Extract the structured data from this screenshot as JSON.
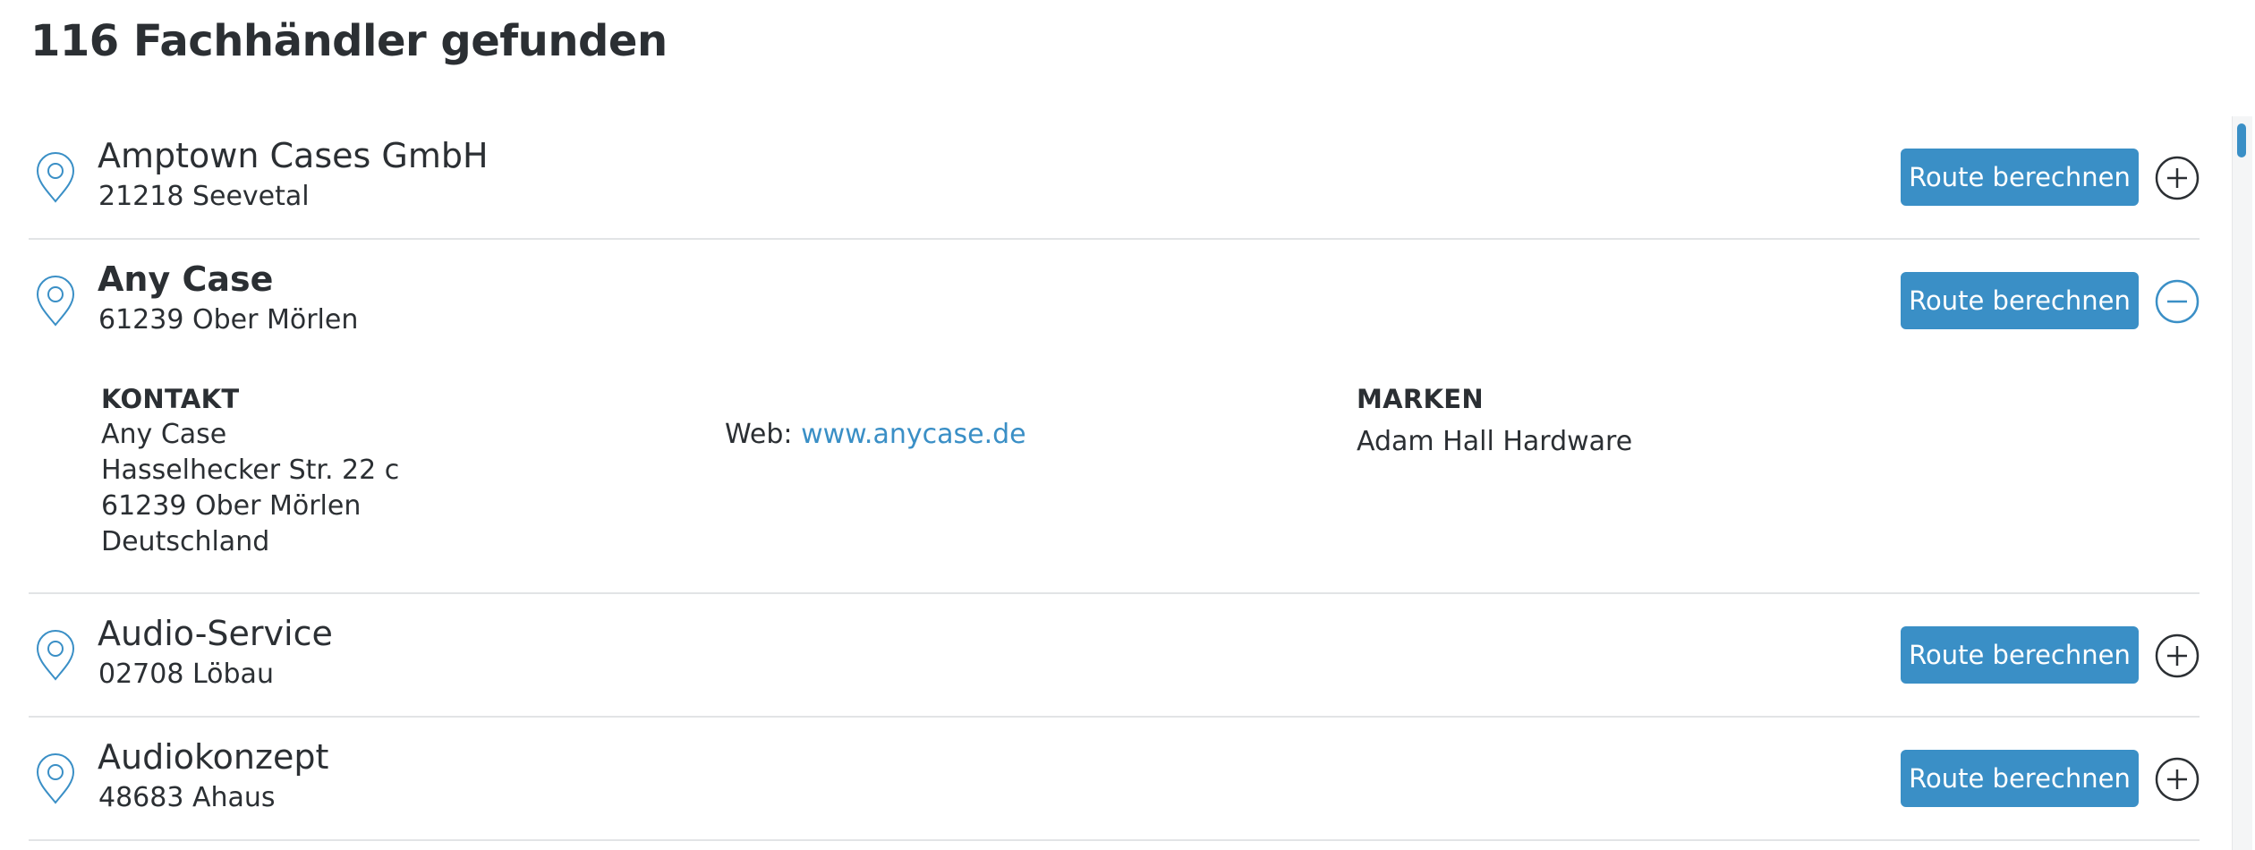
{
  "results_heading": "116 Fachhändler gefunden",
  "colors": {
    "accent": "#3a8fc6",
    "text": "#2b2f33",
    "divider": "#e2e4e6"
  },
  "route_label": "Route berechnen",
  "dealers": [
    {
      "name": "Amptown Cases GmbH",
      "city": "21218 Seevetal",
      "expanded": false
    },
    {
      "name": "Any Case",
      "city": "61239 Ober Mörlen",
      "expanded": true,
      "details": {
        "contact_heading": "KONTAKT",
        "contact_lines": [
          "Any Case",
          "Hasselhecker Str. 22 c",
          "61239 Ober Mörlen",
          "Deutschland"
        ],
        "web_label": "Web:",
        "web_url": "www.anycase.de",
        "brands_heading": "MARKEN",
        "brands": [
          "Adam Hall Hardware"
        ]
      }
    },
    {
      "name": "Audio-Service",
      "city": "02708 Löbau",
      "expanded": false
    },
    {
      "name": "Audiokonzept",
      "city": "48683 Ahaus",
      "expanded": false
    }
  ],
  "icons": {
    "pin": "map-pin-icon",
    "expand": "plus-circle-icon",
    "collapse": "minus-circle-icon"
  }
}
